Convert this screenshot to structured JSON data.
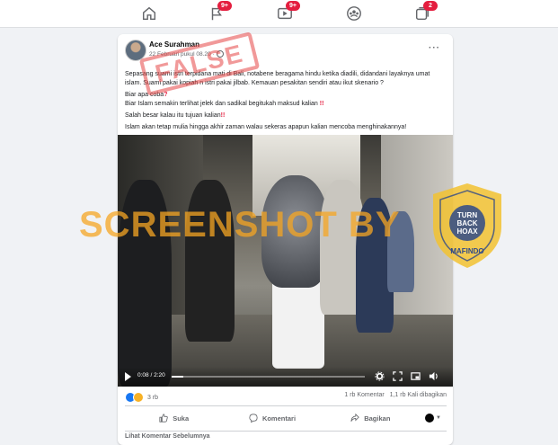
{
  "nav": {
    "notifications_badge": "9+",
    "watch_badge": "9+",
    "gaming_badge": "2"
  },
  "post": {
    "author": "Ace Surahman",
    "timestamp": "22 Februari pukul 08.20",
    "lines": [
      "Sepasang suami istri terpidana mati di Bali, notabene beragama hindu ketika diadili, didandani layaknya umat islam. Suami pakai kopiah n istri pakai jilbab. Kemauan pesakitan sendiri atau ikut skenario ?",
      "Biar apa coba",
      "Biar Islam semakin terlihat jelek dan sadikal begitukah maksud kalian",
      "Salah besar kalau itu tujuan kalian",
      "Islam akan tetap mulia hingga akhir zaman walau sekeras apapun kalian mencoba menghinakannya!"
    ],
    "question_mark": "?",
    "double_excl": "!!"
  },
  "video": {
    "time": "0:08 / 2:20",
    "progress": 0.06
  },
  "watermarks": {
    "stamp": "FALSE",
    "screenshot": "SCREENSHOT BY",
    "mafindo_ring": "MASYARAKAT ANTI FITNAH INDONESIA",
    "mafindo_center": "TURN BACK HOAX",
    "mafindo_name": "MAFINDO"
  },
  "footer": {
    "reaction_count": "3 rb",
    "comments": "1 rb Komentar",
    "shares": "1,1 rb Kali dibagikan",
    "like": "Suka",
    "comment": "Komentari",
    "share": "Bagikan",
    "previous_comments": "Lihat Komentar Sebelumnya"
  }
}
